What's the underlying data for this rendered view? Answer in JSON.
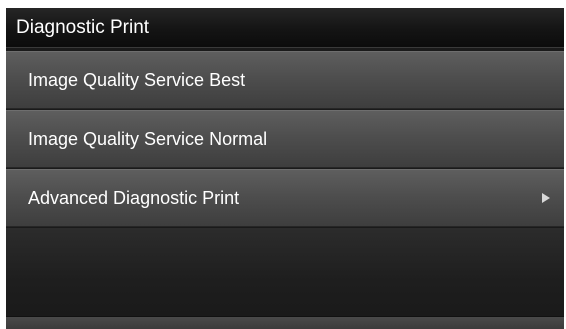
{
  "header": {
    "title": "Diagnostic Print"
  },
  "menu": {
    "items": [
      {
        "label": "Image Quality Service Best",
        "has_submenu": false
      },
      {
        "label": "Image Quality Service Normal",
        "has_submenu": false
      },
      {
        "label": "Advanced Diagnostic Print",
        "has_submenu": true,
        "icon": "chevron-right-icon"
      }
    ]
  },
  "colors": {
    "background": "#1a1a1a",
    "item_background": "#4e4e4e",
    "text": "#ffffff"
  }
}
